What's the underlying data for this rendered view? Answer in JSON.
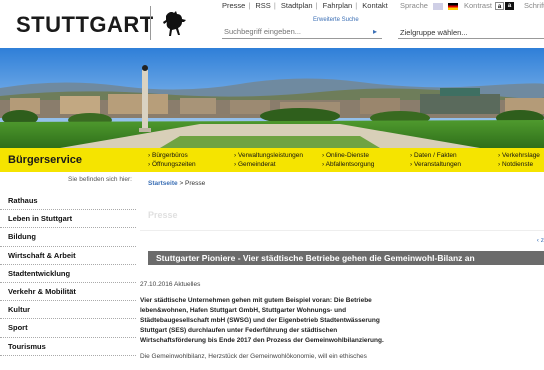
{
  "header": {
    "logo_text": "STUTTGART",
    "topnav": [
      "Presse",
      "RSS",
      "Stadtplan",
      "Fahrplan",
      "Kontakt"
    ],
    "sprache_label": "Sprache",
    "kontrast_label": "Kontrast",
    "kontrast_light": "a",
    "kontrast_dark": "a",
    "schrift_label": "Schrift",
    "advanced_search": "Erweiterte Suche",
    "search_placeholder": "Suchbegriff eingeben...",
    "zielgruppe_placeholder": "Zielgruppe wählen..."
  },
  "band": {
    "title": "Bürgerservice",
    "col1": [
      "Bürgerbüros",
      "Öffnungszeiten"
    ],
    "col2": [
      "Verwaltungsleistungen",
      "Gemeinderat"
    ],
    "col3": [
      "Online-Dienste",
      "Abfallentsorgung"
    ],
    "col4": [
      "Daten / Fakten",
      "Veranstaltungen"
    ],
    "col5": [
      "Verkehrslage",
      "Notdienste"
    ]
  },
  "leftnav": {
    "location_label": "Sie befinden sich hier:",
    "items": [
      "Rathaus",
      "Leben in Stuttgart",
      "Bildung",
      "Wirtschaft & Arbeit",
      "Stadtentwicklung",
      "Verkehr & Mobilität",
      "Kultur",
      "Sport",
      "Tourismus"
    ]
  },
  "content": {
    "breadcrumb_home": "Startseite",
    "breadcrumb_sep": ">",
    "breadcrumb_current": "Presse",
    "section_title": "Presse",
    "prev_link": "‹ z",
    "article_title": "Stuttgarter Pioniere - Vier städtische Betriebe gehen die Gemeinwohl-Bilanz an",
    "article_meta": "27.10.2016 Aktuelles",
    "article_body": [
      "Vier städtische Unternehmen gehen mit gutem Beispiel voran: Die Betriebe",
      "leben&wohnen, Hafen Stuttgart GmbH, Stuttgarter Wohnungs- und",
      "Städtebaugesellschaft mbH (SWSG) und der Eigenbetrieb Stadtentwässerung",
      "Stuttgart (SES) durchlaufen unter Federführung der städtischen",
      "Wirtschaftsförderung bis Ende 2017 den Prozess der Gemeinwohlbilanzierung."
    ],
    "article_body2": "Die Gemeinwohlbilanz, Herzstück der Gemeinwohlökonomie, will ein ethisches"
  },
  "colors": {
    "band": "#f5e400",
    "link": "#3b6fb5",
    "article_bar": "#6b6b6b"
  }
}
